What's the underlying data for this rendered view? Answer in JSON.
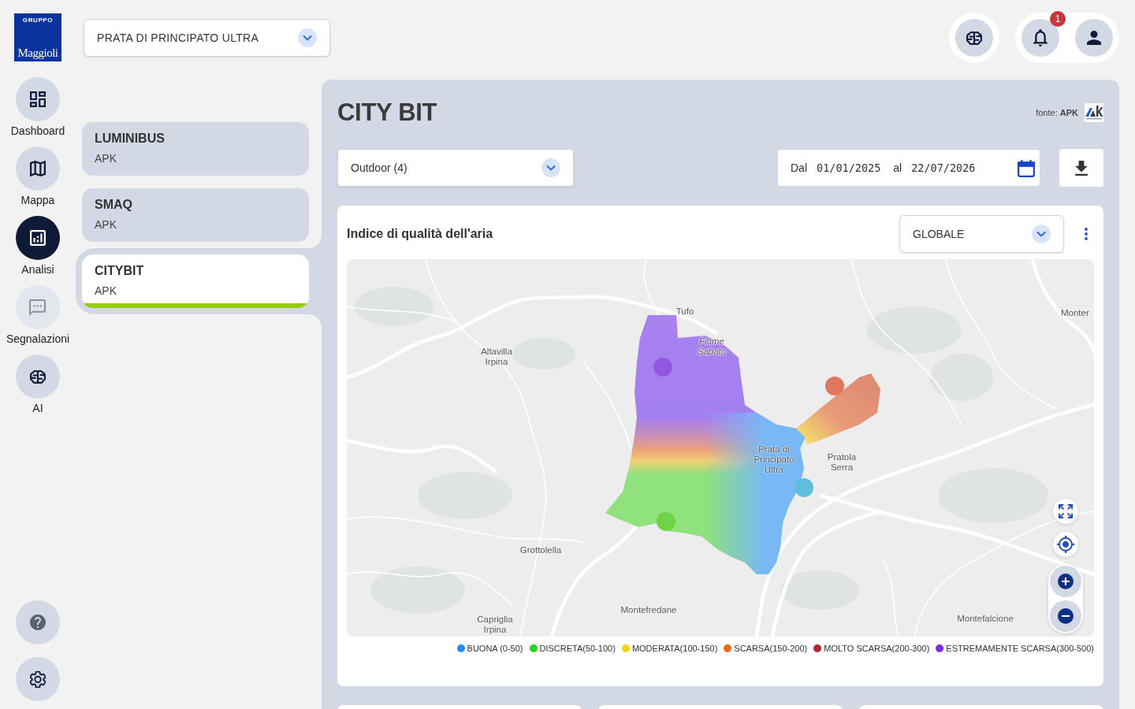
{
  "logo": {
    "caption": "GRUPPO",
    "name": "Maggioli"
  },
  "nav": [
    {
      "label": "Dashboard",
      "selected": false,
      "disabled": false
    },
    {
      "label": "Mappa",
      "selected": false,
      "disabled": false
    },
    {
      "label": "Analisi",
      "selected": true,
      "disabled": false
    },
    {
      "label": "Segnalazioni",
      "selected": false,
      "disabled": true
    },
    {
      "label": "AI",
      "selected": false,
      "disabled": false
    }
  ],
  "location_select": {
    "value": "PRATA DI PRINCIPATO ULTRA"
  },
  "notifications": {
    "count": "1"
  },
  "sources": [
    {
      "name": "LUMINIBUS",
      "provider": "APK",
      "selected": false
    },
    {
      "name": "SMAQ",
      "provider": "APK",
      "selected": false
    },
    {
      "name": "CITYBIT",
      "provider": "APK",
      "selected": true
    }
  ],
  "panel": {
    "title": "CITY BIT",
    "source_note": "fonte: **APK**",
    "station_select": {
      "value": "Outdoor (4)"
    },
    "date_range": {
      "from_label": "Dal",
      "from": "01/01/2025",
      "to_label": "al",
      "to": "22/07/2026"
    }
  },
  "aqi_card": {
    "title": "Indice di qualità dell'aria",
    "index_select": {
      "value": "GLOBALE"
    },
    "place_labels": [
      {
        "text": "Tufo",
        "kind": "town"
      },
      {
        "text": "Monter",
        "kind": "town"
      },
      {
        "text": "Fiume Sabato",
        "kind": "river"
      },
      {
        "text": "Altavilla Irpina",
        "kind": "town"
      },
      {
        "text": "Prata di Principato Ultra",
        "kind": "town"
      },
      {
        "text": "Pratola Serra",
        "kind": "town"
      },
      {
        "text": "Grottolella",
        "kind": "town"
      },
      {
        "text": "Montefredane",
        "kind": "town"
      },
      {
        "text": "Montefalcione",
        "kind": "town"
      },
      {
        "text": "Capriglia Irpina",
        "kind": "town"
      }
    ],
    "legend": [
      {
        "label": "BUONA (0-50)",
        "color": "#1e8fff"
      },
      {
        "label": "DISCRETA(50-100)",
        "color": "#22d81e"
      },
      {
        "label": "MODERATA(100-150)",
        "color": "#f5d40a"
      },
      {
        "label": "SCARSA(150-200)",
        "color": "#f2651c"
      },
      {
        "label": "MOLTO SCARSA(200-300)",
        "color": "#b0282a"
      },
      {
        "label": "ESTREMAMENTE SCARSA(300-500)",
        "color": "#7a2cf5"
      }
    ]
  }
}
